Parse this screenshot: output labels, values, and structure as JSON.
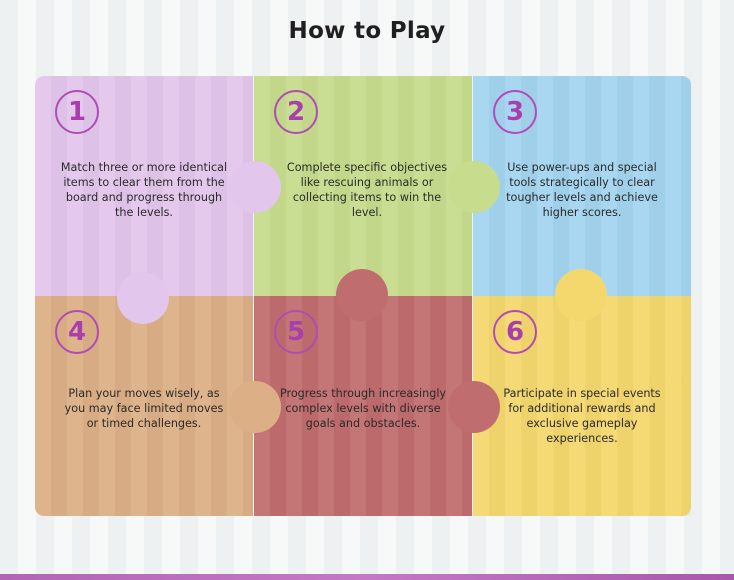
{
  "title": "How to Play",
  "colors": {
    "tile1": "#e3c6ec",
    "tile2": "#c7dc8c",
    "tile3": "#a4d4ef",
    "tile4": "#dcaf86",
    "tile5": "#c06d6f",
    "tile6": "#f4d86e",
    "badge": "#b04cb4",
    "bottom_bar": "#b264b5"
  },
  "tiles": [
    {
      "number": "1",
      "text": "Match three or more identical items to clear them from the board and progress through the levels."
    },
    {
      "number": "2",
      "text": "Complete specific objectives like rescuing animals or collecting items to win the level."
    },
    {
      "number": "3",
      "text": "Use power-ups and special tools strategically to clear tougher levels and achieve higher scores."
    },
    {
      "number": "4",
      "text": "Plan your moves wisely, as you may face limited moves or timed challenges."
    },
    {
      "number": "5",
      "text": "Progress through increasingly complex levels with diverse goals and obstacles."
    },
    {
      "number": "6",
      "text": "Participate in special events for additional rewards and exclusive gameplay experiences."
    }
  ]
}
